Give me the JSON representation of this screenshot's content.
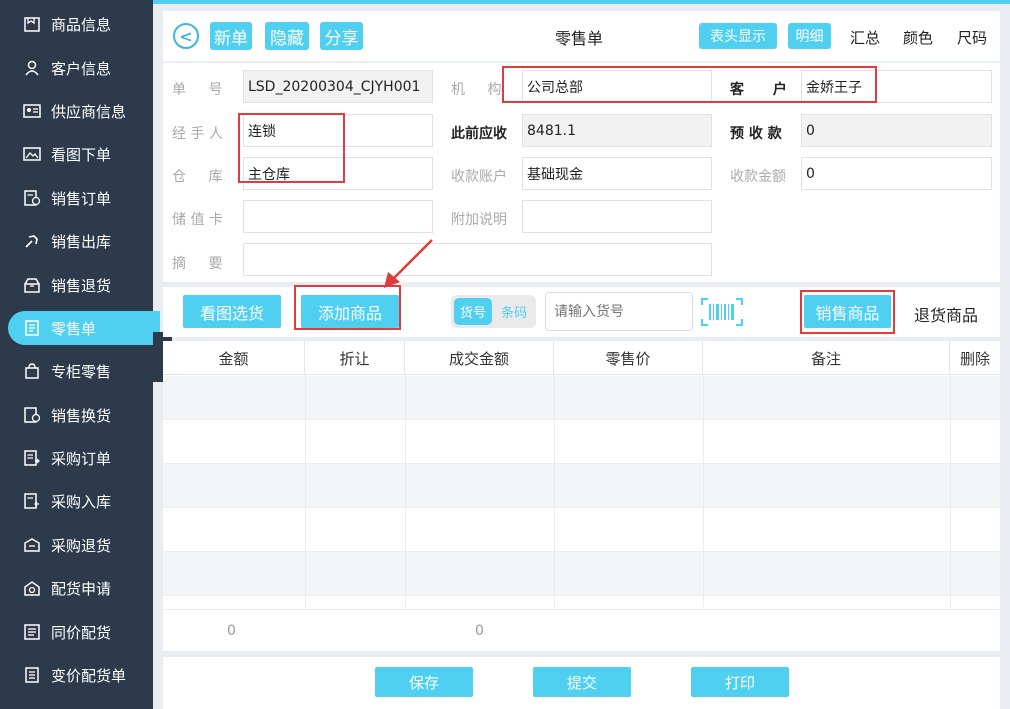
{
  "sidebar": {
    "items": [
      {
        "label": "商品信息",
        "icon": "product-info-icon"
      },
      {
        "label": "客户信息",
        "icon": "person-icon"
      },
      {
        "label": "供应商信息",
        "icon": "id-card-icon"
      },
      {
        "label": "看图下单",
        "icon": "image-icon"
      },
      {
        "label": "销售订单",
        "icon": "order-doc-icon"
      },
      {
        "label": "销售出库",
        "icon": "outbound-icon"
      },
      {
        "label": "销售退货",
        "icon": "return-box-icon"
      },
      {
        "label": "零售单",
        "icon": "document-icon"
      },
      {
        "label": "专柜零售",
        "icon": "counter-bag-icon"
      },
      {
        "label": "销售换货",
        "icon": "exchange-icon"
      },
      {
        "label": "采购订单",
        "icon": "purchase-order-icon"
      },
      {
        "label": "采购入库",
        "icon": "inbound-icon"
      },
      {
        "label": "采购退货",
        "icon": "purchase-return-icon"
      },
      {
        "label": "配货申请",
        "icon": "request-icon"
      },
      {
        "label": "同价配货",
        "icon": "same-price-icon"
      },
      {
        "label": "变价配货单",
        "icon": "price-change-icon"
      }
    ],
    "collapse_glyph": "《"
  },
  "toolbar": {
    "back_glyph": "<",
    "new_label": "新单",
    "hide_label": "隐藏",
    "share_label": "分享",
    "title": "零售单",
    "header_display_label": "表头显示",
    "detail_label": "明细",
    "summary_label": "汇总",
    "color_label": "颜色",
    "size_label": "尺码"
  },
  "form": {
    "order_no_label": "单 号",
    "order_no_value": "LSD_20200304_CJYH001",
    "org_label": "机 构",
    "org_value": "公司总部",
    "customer_label": "客 户",
    "customer_value": "金娇王子",
    "handler_label": "经 手 人",
    "handler_value": "连锁",
    "prev_receivable_label": "此前应收",
    "prev_receivable_value": "8481.1",
    "prepaid_label": "预 收 款",
    "prepaid_value": "0",
    "warehouse_label": "仓 库",
    "warehouse_value": "主仓库",
    "account_label": "收款账户",
    "account_value": "基础现金",
    "amount_label": "收款金额",
    "amount_value": "0",
    "card_label": "储 值 卡",
    "card_value": "",
    "note_label": "附加说明",
    "note_value": "",
    "memo_label": "摘 要",
    "memo_value": ""
  },
  "actions": {
    "view_pick_label": "看图选货",
    "add_product_label": "添加商品",
    "toggle_sku_label": "货号",
    "toggle_barcode_label": "条码",
    "search_placeholder": "请输入货号",
    "sale_product_label": "销售商品",
    "return_product_label": "退货商品"
  },
  "table": {
    "columns": [
      "金额",
      "折让",
      "成交金额",
      "零售价",
      "备注",
      "删除"
    ],
    "rows": [],
    "footer_amount": "0",
    "footer_deal_amount": "0"
  },
  "bottom": {
    "save_label": "保存",
    "submit_label": "提交",
    "print_label": "打印"
  },
  "colors": {
    "accent": "#4fd0f0",
    "sidebar_bg": "#2c3a4b",
    "annotation_red": "#e23b3b"
  }
}
